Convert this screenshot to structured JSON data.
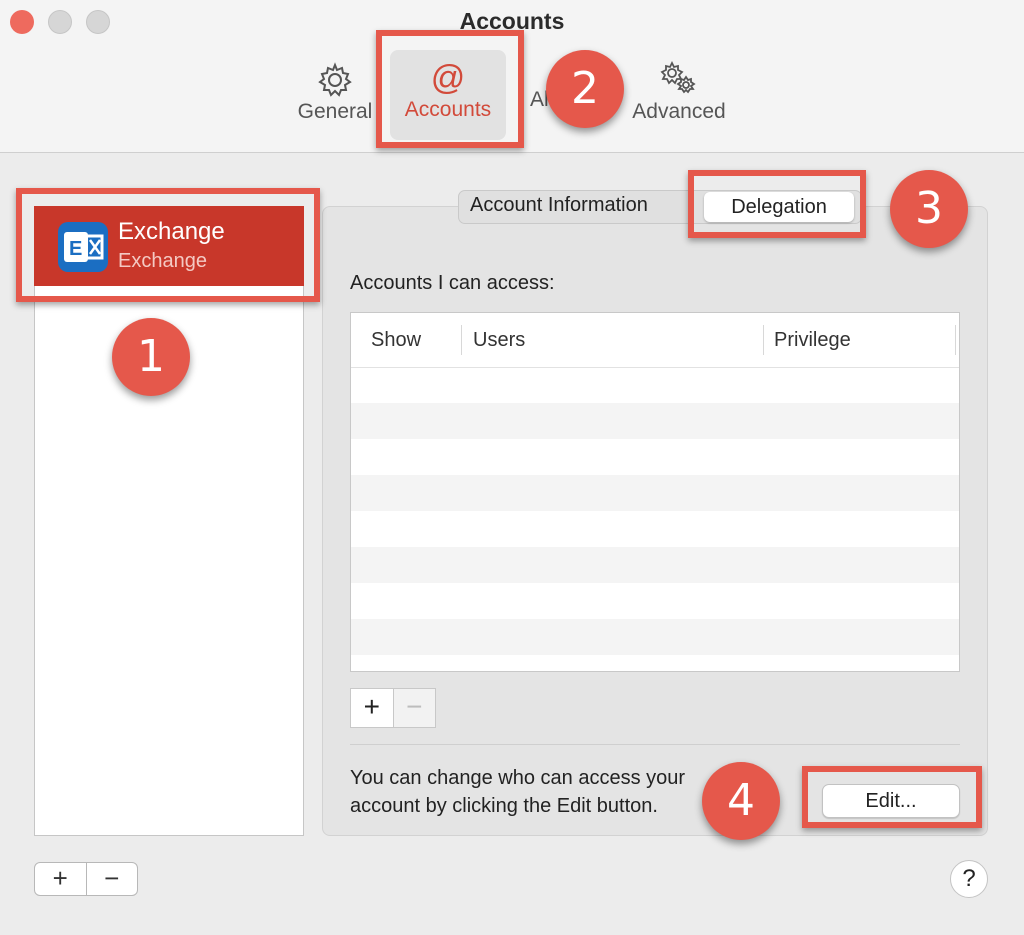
{
  "window": {
    "title": "Accounts"
  },
  "toolbar": {
    "general": "General",
    "accounts": "Accounts",
    "alerts": "Alerts",
    "advanced": "Advanced"
  },
  "sidebar": {
    "account_name": "Exchange",
    "account_type": "Exchange",
    "add": "+",
    "remove": "−"
  },
  "tabs": {
    "account_information": "Account Information",
    "delegation": "Delegation"
  },
  "delegation": {
    "label": "Accounts I can access:",
    "columns": [
      "Show",
      "Users",
      "Privilege"
    ],
    "add": "+",
    "remove": "−",
    "description": "You can change who can access your account by clicking the Edit button.",
    "edit": "Edit..."
  },
  "help": "?",
  "annotations": {
    "b1": "1",
    "b2": "2",
    "b3": "3",
    "b4": "4"
  },
  "colors": {
    "accent": "#c8372a",
    "annotation": "#e5584b"
  }
}
